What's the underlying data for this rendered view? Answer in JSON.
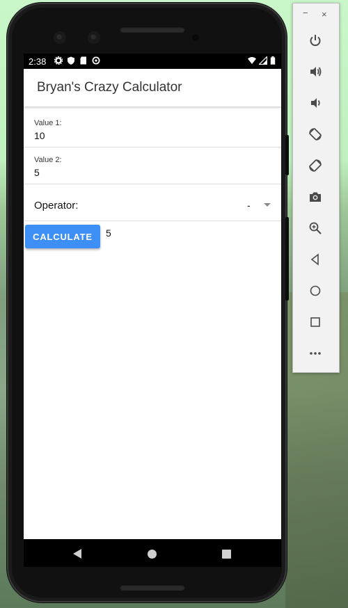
{
  "status_bar": {
    "time": "2:38",
    "icons": [
      "gear-icon",
      "shield-icon",
      "sd-card-icon",
      "sync-icon"
    ],
    "right_icons": [
      "wifi-icon",
      "signal-icon",
      "battery-icon"
    ]
  },
  "app_bar": {
    "title": "Bryan's Crazy Calculator"
  },
  "form": {
    "value1": {
      "label": "Value 1:",
      "value": "10"
    },
    "value2": {
      "label": "Value 2:",
      "value": "5"
    },
    "operator": {
      "label": "Operator:",
      "selected": "-"
    },
    "calculate_label": "CALCULATE",
    "result": "5"
  },
  "nav_bar": {
    "icons": [
      "back-icon",
      "home-icon",
      "recents-icon"
    ]
  },
  "emulator_toolbar": {
    "window_controls": {
      "minimize": "−",
      "close": "×"
    },
    "buttons": [
      "power-icon",
      "volume-up-icon",
      "volume-down-icon",
      "rotate-left-icon",
      "rotate-right-icon",
      "camera-icon",
      "zoom-icon",
      "back-icon",
      "home-icon",
      "overview-icon",
      "more-icon"
    ],
    "more_label": "•••"
  },
  "colors": {
    "accent": "#3d8ef5",
    "app_bar_bg": "#ffffff",
    "phone_frame": "#1b1b1b",
    "background": "#c9f7c9"
  }
}
